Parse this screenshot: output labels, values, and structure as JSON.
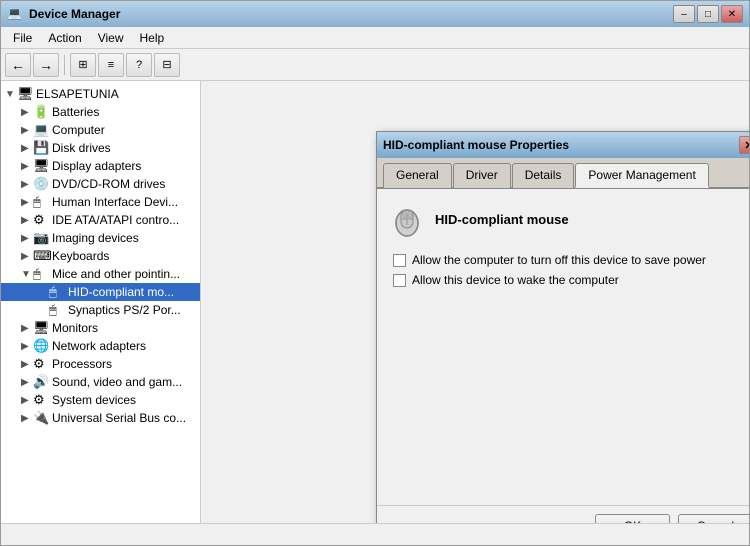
{
  "mainWindow": {
    "title": "Device Manager",
    "icon": "💻"
  },
  "titleButtons": {
    "minimize": "–",
    "maximize": "□",
    "close": "✕"
  },
  "menuBar": {
    "items": [
      "File",
      "Action",
      "View",
      "Help"
    ]
  },
  "toolbar": {
    "buttons": [
      "←",
      "→",
      "⊞",
      "≡",
      "?",
      "⊟"
    ]
  },
  "tree": {
    "rootLabel": "ELSAPETUNIA",
    "items": [
      {
        "label": "Batteries",
        "indent": 1,
        "expanded": false,
        "icon": "🔋"
      },
      {
        "label": "Computer",
        "indent": 1,
        "expanded": false,
        "icon": "💻"
      },
      {
        "label": "Disk drives",
        "indent": 1,
        "expanded": false,
        "icon": "💾"
      },
      {
        "label": "Display adapters",
        "indent": 1,
        "expanded": false,
        "icon": "🖥"
      },
      {
        "label": "DVD/CD-ROM drives",
        "indent": 1,
        "expanded": false,
        "icon": "💿"
      },
      {
        "label": "Human Interface Devi...",
        "indent": 1,
        "expanded": false,
        "icon": "🖱"
      },
      {
        "label": "IDE ATA/ATAPI contro...",
        "indent": 1,
        "expanded": false,
        "icon": "⚙"
      },
      {
        "label": "Imaging devices",
        "indent": 1,
        "expanded": false,
        "icon": "📷"
      },
      {
        "label": "Keyboards",
        "indent": 1,
        "expanded": false,
        "icon": "⌨"
      },
      {
        "label": "Mice and other pointin...",
        "indent": 1,
        "expanded": true,
        "icon": "🖱"
      },
      {
        "label": "HID-compliant mo...",
        "indent": 2,
        "expanded": false,
        "icon": "🖱"
      },
      {
        "label": "Synaptics PS/2 Por...",
        "indent": 2,
        "expanded": false,
        "icon": "🖱"
      },
      {
        "label": "Monitors",
        "indent": 1,
        "expanded": false,
        "icon": "🖥"
      },
      {
        "label": "Network adapters",
        "indent": 1,
        "expanded": false,
        "icon": "🌐"
      },
      {
        "label": "Processors",
        "indent": 1,
        "expanded": false,
        "icon": "⚙"
      },
      {
        "label": "Sound, video and gam...",
        "indent": 1,
        "expanded": false,
        "icon": "🔊"
      },
      {
        "label": "System devices",
        "indent": 1,
        "expanded": false,
        "icon": "⚙"
      },
      {
        "label": "Universal Serial Bus co...",
        "indent": 1,
        "expanded": false,
        "icon": "🔌"
      }
    ]
  },
  "dialog": {
    "title": "HID-compliant mouse Properties",
    "tabs": [
      "General",
      "Driver",
      "Details",
      "Power Management"
    ],
    "activeTab": "Power Management",
    "deviceName": "HID-compliant mouse",
    "options": [
      {
        "label": "Allow the computer to turn off this device to save power",
        "checked": false
      },
      {
        "label": "Allow this device to wake the computer",
        "checked": false
      }
    ],
    "buttons": {
      "ok": "OK",
      "cancel": "Cancel"
    }
  },
  "statusBar": {
    "text": ""
  }
}
